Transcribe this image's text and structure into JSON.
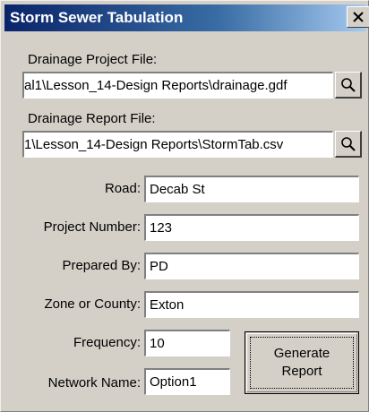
{
  "window": {
    "title": "Storm Sewer Tabulation",
    "close_glyph": "✕"
  },
  "drainage_project": {
    "label": "Drainage Project File:",
    "value": "al1\\Lesson_14-Design Reports\\drainage.gdf",
    "browse_icon": "search-icon"
  },
  "drainage_report": {
    "label": "Drainage Report File:",
    "value": "1\\Lesson_14-Design Reports\\StormTab.csv",
    "browse_icon": "search-icon"
  },
  "fields": {
    "road": {
      "label": "Road:",
      "value": "Decab St"
    },
    "project_number": {
      "label": "Project Number:",
      "value": "123"
    },
    "prepared_by": {
      "label": "Prepared By:",
      "value": "PD"
    },
    "zone": {
      "label": "Zone or County:",
      "value": "Exton"
    },
    "frequency": {
      "label": "Frequency:",
      "value": "10"
    },
    "network_name": {
      "label": "Network Name:",
      "value": "Option1"
    }
  },
  "generate_button": {
    "line1": "Generate",
    "line2": "Report"
  }
}
